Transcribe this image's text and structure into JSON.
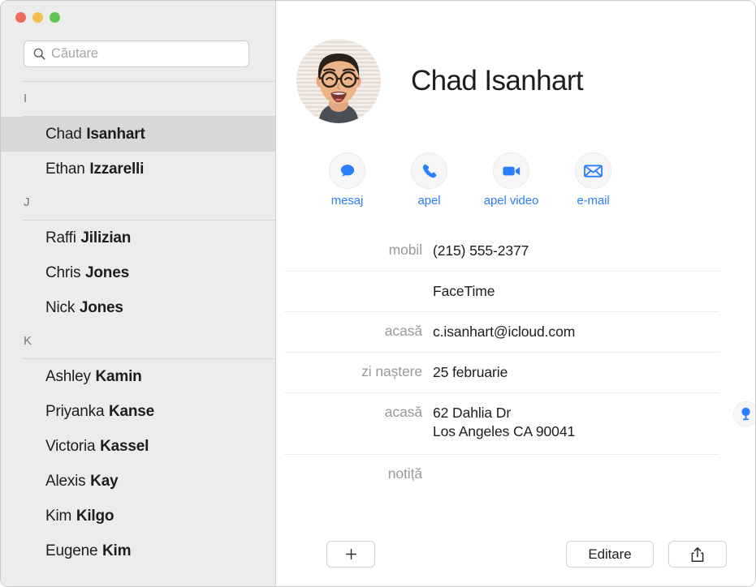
{
  "window": {
    "traffic_lights": [
      {
        "name": "close",
        "color": "#ed6a5f"
      },
      {
        "name": "minimize",
        "color": "#f5bf4f"
      },
      {
        "name": "zoom",
        "color": "#61c555"
      }
    ]
  },
  "sidebar": {
    "search": {
      "placeholder": "Căutare",
      "value": "",
      "icon": "search-icon"
    },
    "sections": [
      {
        "letter": "I",
        "contacts": [
          {
            "given": "Chad",
            "family": "Isanhart",
            "selected": true
          },
          {
            "given": "Ethan",
            "family": "Izzarelli",
            "selected": false
          }
        ]
      },
      {
        "letter": "J",
        "contacts": [
          {
            "given": "Raffi",
            "family": "Jilizian",
            "selected": false
          },
          {
            "given": "Chris",
            "family": "Jones",
            "selected": false
          },
          {
            "given": "Nick",
            "family": "Jones",
            "selected": false
          }
        ]
      },
      {
        "letter": "K",
        "contacts": [
          {
            "given": "Ashley",
            "family": "Kamin",
            "selected": false
          },
          {
            "given": "Priyanka",
            "family": "Kanse",
            "selected": false
          },
          {
            "given": "Victoria",
            "family": "Kassel",
            "selected": false
          },
          {
            "given": "Alexis",
            "family": "Kay",
            "selected": false
          },
          {
            "given": "Kim",
            "family": "Kilgo",
            "selected": false
          },
          {
            "given": "Eugene",
            "family": "Kim",
            "selected": false
          }
        ]
      }
    ]
  },
  "detail": {
    "name": "Chad Isanhart",
    "avatar_alt": "contact-photo",
    "accent_color": "#2b7efd",
    "quick_actions": [
      {
        "label": "mesaj",
        "icon": "message-bubble-icon"
      },
      {
        "label": "apel",
        "icon": "phone-icon"
      },
      {
        "label": "apel video",
        "icon": "video-camera-icon"
      },
      {
        "label": "e-mail",
        "icon": "envelope-icon"
      }
    ],
    "fields": [
      {
        "label": "mobil",
        "value": "(215) 555-2377",
        "lines": [
          "(215) 555-2377"
        ],
        "divider_above": false
      },
      {
        "label": "",
        "value": "FaceTime",
        "lines": [
          "FaceTime"
        ],
        "divider_above": true
      },
      {
        "label": "acasă",
        "value": "c.isanhart@icloud.com",
        "lines": [
          "c.isanhart@icloud.com"
        ],
        "divider_above": true
      },
      {
        "label": "zi naștere",
        "value": "25 februarie",
        "lines": [
          "25 februarie"
        ],
        "divider_above": true
      },
      {
        "label": "acasă",
        "value": "62 Dahlia Dr Los Angeles CA 90041",
        "lines": [
          "62 Dahlia Dr",
          "Los Angeles CA 90041"
        ],
        "divider_above": true,
        "map_pin": true
      },
      {
        "label": "notiță",
        "value": "",
        "lines": [],
        "divider_above": true
      }
    ]
  },
  "bottom_bar": {
    "add_label": "",
    "add_icon": "plus-icon",
    "edit_label": "Editare",
    "share_icon": "share-icon"
  }
}
